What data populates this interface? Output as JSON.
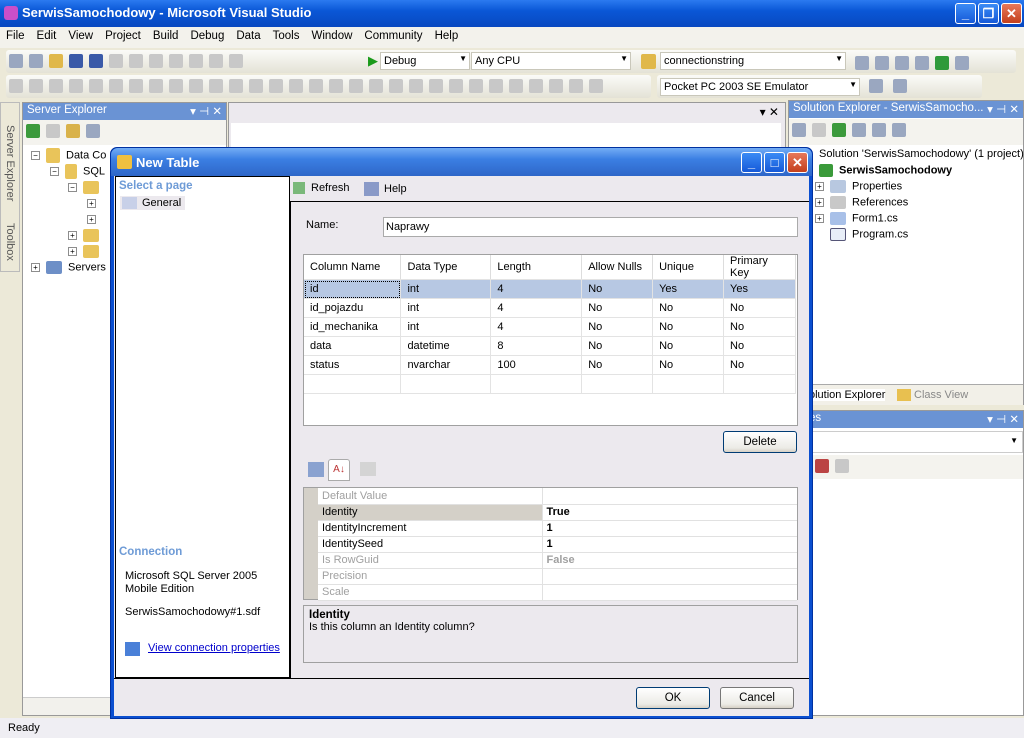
{
  "window": {
    "title": "SerwisSamochodowy - Microsoft Visual Studio"
  },
  "menu": [
    "File",
    "Edit",
    "View",
    "Project",
    "Build",
    "Debug",
    "Data",
    "Tools",
    "Window",
    "Community",
    "Help"
  ],
  "toolbar": {
    "config": "Debug",
    "platform": "Any CPU",
    "find": "connectionstring",
    "device": "Pocket PC 2003 SE Emulator"
  },
  "server_explorer": {
    "title": "Server Explorer",
    "items": [
      "Data Co",
      "SQL",
      "Servers"
    ]
  },
  "side_tabs": {
    "server": "Server Explorer",
    "toolbox": "Toolbox"
  },
  "solution_explorer": {
    "title": "Solution Explorer - SerwisSamocho...",
    "solution": "Solution 'SerwisSamochodowy' (1 project)",
    "project": "SerwisSamochodowy",
    "items": [
      "Properties",
      "References",
      "Form1.cs",
      "Program.cs"
    ],
    "tabs": [
      "olution Explorer",
      "Class View"
    ]
  },
  "properties": {
    "title": "erties"
  },
  "status": "Ready",
  "dialog": {
    "title": "New Table",
    "select_page": "Select a page",
    "page_general": "General",
    "connection_label": "Connection",
    "server": "Microsoft SQL Server 2005",
    "edition": "Mobile Edition",
    "file": "SerwisSamochodowy#1.sdf",
    "view_props": "View connection properties",
    "refresh": "Refresh",
    "help": "Help",
    "name_label": "Name:",
    "name_value": "Naprawy",
    "columns": [
      "Column Name",
      "Data Type",
      "Length",
      "Allow Nulls",
      "Unique",
      "Primary Key"
    ],
    "rows": [
      [
        "id",
        "int",
        "4",
        "No",
        "Yes",
        "Yes"
      ],
      [
        "id_pojazdu",
        "int",
        "4",
        "No",
        "No",
        "No"
      ],
      [
        "id_mechanika",
        "int",
        "4",
        "No",
        "No",
        "No"
      ],
      [
        "data",
        "datetime",
        "8",
        "No",
        "No",
        "No"
      ],
      [
        "status",
        "nvarchar",
        "100",
        "No",
        "No",
        "No"
      ]
    ],
    "delete": "Delete",
    "props": [
      {
        "name": "Default Value",
        "value": "",
        "disabled": true
      },
      {
        "name": "Identity",
        "value": "True",
        "selected": true
      },
      {
        "name": "IdentityIncrement",
        "value": "1"
      },
      {
        "name": "IdentitySeed",
        "value": "1"
      },
      {
        "name": "Is RowGuid",
        "value": "False",
        "disabled": true
      },
      {
        "name": "Precision",
        "value": "",
        "disabled": true
      },
      {
        "name": "Scale",
        "value": "",
        "disabled": true
      }
    ],
    "desc_title": "Identity",
    "desc_text": "Is this column an Identity column?",
    "ok": "OK",
    "cancel": "Cancel"
  }
}
